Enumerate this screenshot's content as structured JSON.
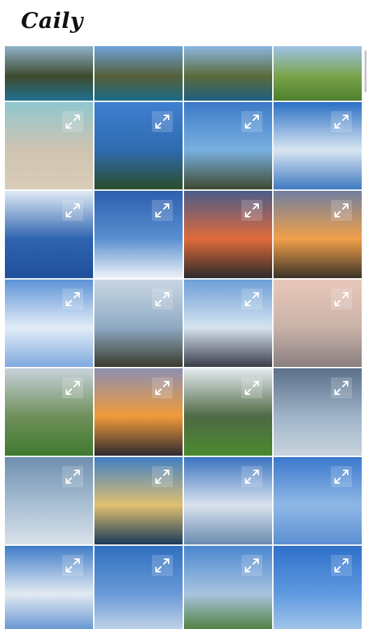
{
  "app": {
    "logo_text": "Caily"
  },
  "gallery": {
    "photos": [
      {
        "id": "p1",
        "desc": "sea-arch-cliff",
        "colors": [
          "#8fb3c9",
          "#3e4a2e",
          "#1f6f8f"
        ],
        "expand": false
      },
      {
        "id": "p2",
        "desc": "sea-cliff-blue-sky",
        "colors": [
          "#6fa3d8",
          "#55603a",
          "#1c6a86"
        ],
        "expand": false
      },
      {
        "id": "p3",
        "desc": "sea-cliff-grass",
        "colors": [
          "#8cb6e0",
          "#5b6b3c",
          "#1e5f80"
        ],
        "expand": false
      },
      {
        "id": "p4",
        "desc": "green-field-sky",
        "colors": [
          "#9ec3e8",
          "#7aa34a",
          "#4d7f2c"
        ],
        "expand": false
      },
      {
        "id": "p5",
        "desc": "beach-shore",
        "colors": [
          "#8fc7cf",
          "#cfc4b0",
          "#d9cdb8"
        ],
        "expand": true
      },
      {
        "id": "p6",
        "desc": "blue-sky-forest",
        "colors": [
          "#3f7fd0",
          "#2e6bb0",
          "#2a4d2a"
        ],
        "expand": true
      },
      {
        "id": "p7",
        "desc": "sky-clouds-town",
        "colors": [
          "#3c7ac8",
          "#7ab0e0",
          "#3d4a30"
        ],
        "expand": true
      },
      {
        "id": "p8",
        "desc": "airplane-wing-clouds",
        "colors": [
          "#2a6fc4",
          "#d9e6f2",
          "#3f7ac0"
        ],
        "expand": true
      },
      {
        "id": "p9",
        "desc": "aerial-island-ocean",
        "colors": [
          "#e0ebf5",
          "#2f64b0",
          "#1f4f9a"
        ],
        "expand": true
      },
      {
        "id": "p10",
        "desc": "clouds-from-plane",
        "colors": [
          "#2d5fae",
          "#5a8fd0",
          "#eef3f8"
        ],
        "expand": true
      },
      {
        "id": "p11",
        "desc": "sunset-coast-red",
        "colors": [
          "#4b5c8a",
          "#e06a3a",
          "#2b2b2b"
        ],
        "expand": true
      },
      {
        "id": "p12",
        "desc": "sunset-coast-orange",
        "colors": [
          "#6f7fa0",
          "#f2a04a",
          "#3a3228"
        ],
        "expand": true
      },
      {
        "id": "p13",
        "desc": "patchy-clouds-sky",
        "colors": [
          "#5d93d6",
          "#e3edf7",
          "#7fa9de"
        ],
        "expand": true
      },
      {
        "id": "p14",
        "desc": "palm-trees-clouds",
        "colors": [
          "#c9d6e3",
          "#8faac4",
          "#3a3a2a"
        ],
        "expand": true
      },
      {
        "id": "p15",
        "desc": "building-under-clouds",
        "colors": [
          "#6c9fd8",
          "#d6e3ef",
          "#3a3e4a"
        ],
        "expand": true
      },
      {
        "id": "p16",
        "desc": "calm-sea-dusk",
        "colors": [
          "#e8c7b8",
          "#c9b2a8",
          "#8a7f80"
        ],
        "expand": true
      },
      {
        "id": "p17",
        "desc": "field-evening",
        "colors": [
          "#c8d2dc",
          "#6f8f5a",
          "#3f7a2f"
        ],
        "expand": true
      },
      {
        "id": "p18",
        "desc": "sunset-harbor",
        "colors": [
          "#8c8fb0",
          "#f09a3a",
          "#2e2a30"
        ],
        "expand": true
      },
      {
        "id": "p19",
        "desc": "green-mountain-field",
        "colors": [
          "#e5ebf1",
          "#4f6a45",
          "#4a8a2e"
        ],
        "expand": true
      },
      {
        "id": "p20",
        "desc": "plane-wing-grey-sky",
        "colors": [
          "#5a6f8a",
          "#9fb4c8",
          "#c9d4de"
        ],
        "expand": true
      },
      {
        "id": "p21",
        "desc": "plane-wing-clouds",
        "colors": [
          "#6f8fb0",
          "#a9bfd3",
          "#d8e1e9"
        ],
        "expand": true
      },
      {
        "id": "p22",
        "desc": "palace-reflection",
        "colors": [
          "#3f7fc4",
          "#e0c070",
          "#1a3a5a"
        ],
        "expand": true
      },
      {
        "id": "p23",
        "desc": "cloud-layer-aerial",
        "colors": [
          "#3a73c0",
          "#d9e3ee",
          "#6a8bb0"
        ],
        "expand": true
      },
      {
        "id": "p24",
        "desc": "wing-blue-sky",
        "colors": [
          "#3b78cc",
          "#8fb8e6",
          "#5b8ed2"
        ],
        "expand": true
      },
      {
        "id": "p25",
        "desc": "wing-clouds-low",
        "colors": [
          "#3f7cc8",
          "#e3eaf2",
          "#5a8fd0"
        ],
        "expand": true
      },
      {
        "id": "p26",
        "desc": "wing-clouds-horizon",
        "colors": [
          "#2f6fc0",
          "#6a9ad8",
          "#c9d8e8"
        ],
        "expand": true
      },
      {
        "id": "p27",
        "desc": "road-sign-field",
        "colors": [
          "#4a87d0",
          "#a8c4e0",
          "#4a7a30"
        ],
        "expand": true
      },
      {
        "id": "p28",
        "desc": "wind-turbine",
        "colors": [
          "#2f6fc8",
          "#5f9ae0",
          "#a9c8ea"
        ],
        "expand": true
      }
    ]
  }
}
